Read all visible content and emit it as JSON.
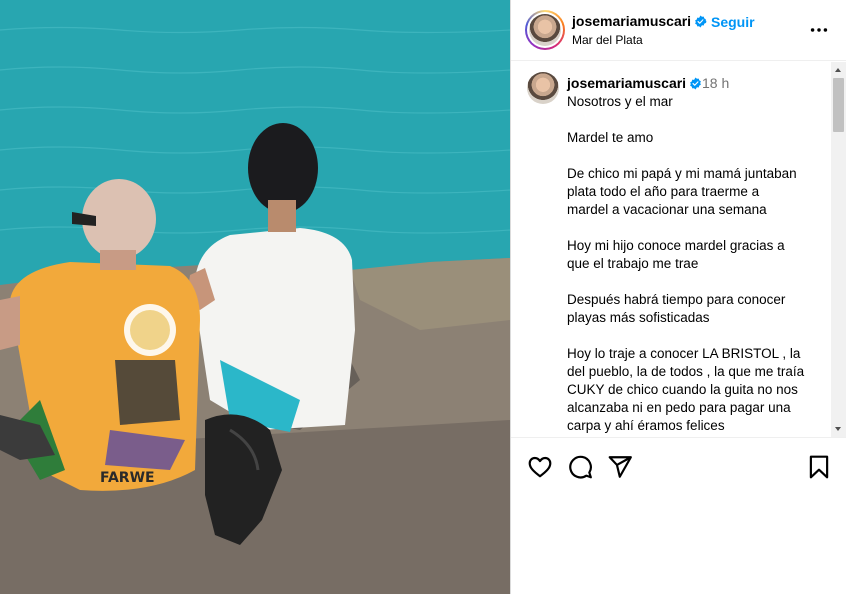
{
  "post": {
    "username": "josemariamuscari",
    "follow_separator": "•",
    "follow_label": "Seguir",
    "location": "Mar del Plata",
    "verified_icon": "verified-badge-icon",
    "more_icon": "more-options-icon"
  },
  "caption": {
    "username": "josemariamuscari",
    "time": "18 h",
    "lines": [
      "Nosotros y el mar",
      "",
      "Mardel te amo",
      "",
      "De chico mi papá y mi mamá juntaban",
      "plata todo el año para traerme a",
      "mardel a vacacionar una semana",
      "",
      "Hoy mi hijo conoce mardel gracias a",
      "que el trabajo me trae",
      "",
      "Después habrá tiempo para conocer",
      "playas más sofisticadas",
      "",
      "Hoy lo traje a conocer LA BRISTOL , la",
      "del pueblo, la de todos , la que me traía",
      "CUKY de chico cuando la guita no nos",
      "alcanzaba ni en pedo para pagar una",
      "carpa y ahí éramos felices"
    ]
  },
  "actions": {
    "like_icon": "heart-icon",
    "comment_icon": "comment-icon",
    "share_icon": "share-icon",
    "save_icon": "bookmark-icon"
  },
  "colors": {
    "link_blue": "#0095f6",
    "verified_blue": "#0095f6",
    "muted_text": "#737373",
    "sea": "#27a3ad",
    "shirt_yellow": "#f2a93b"
  }
}
